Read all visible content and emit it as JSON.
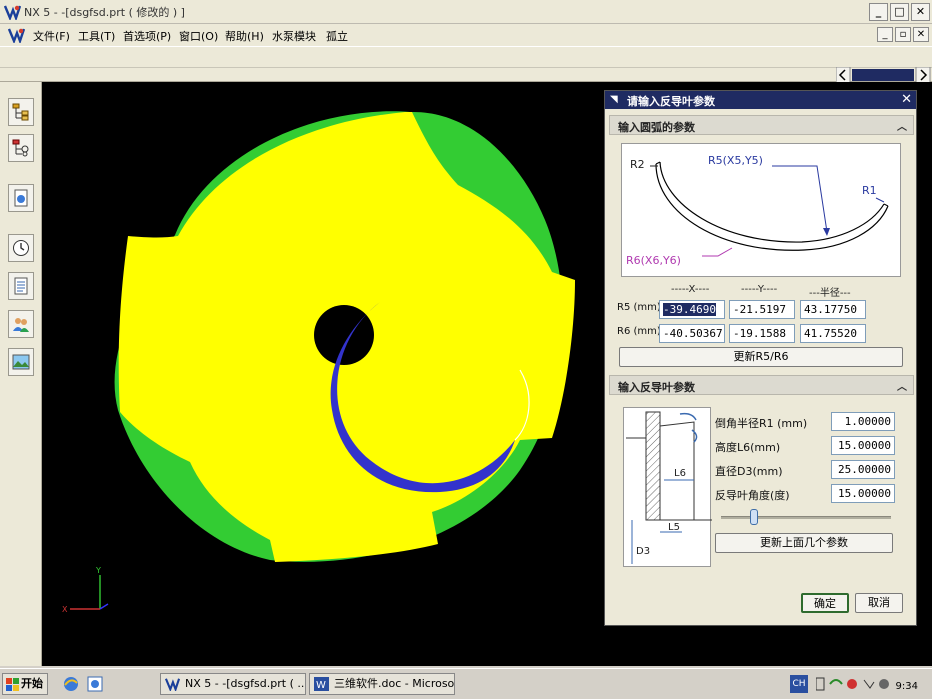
{
  "window": {
    "title": "NX 5 - -[dsgfsd.prt ( 修改的 ) ]",
    "controls": {
      "minimize": "_",
      "maximize": "□",
      "close": "✕"
    }
  },
  "menu": {
    "items": [
      "文件(F)",
      "工具(T)",
      "首选项(P)",
      "窗口(O)",
      "帮助(H)",
      "水泵模块",
      "孤立"
    ]
  },
  "viewport": {
    "triad": {
      "x_label": "X",
      "y_label": "Y"
    },
    "colors": {
      "background": "#000000",
      "impeller_face": "#ffff00",
      "impeller_side": "#33cc33",
      "blade": "#3333cc"
    }
  },
  "dialog": {
    "title": "请输入反导叶参数",
    "section1": {
      "title": "输入圆弧的参数",
      "figure_labels": {
        "r2": "R2",
        "r5": "R5(X5,Y5)",
        "r1": "R1",
        "r6": "R6(X6,Y6)"
      },
      "col_x": "-----X----",
      "col_y": "-----Y----",
      "col_r": "---半径---",
      "r5_label": "R5 (mm)",
      "r6_label": "R6 (mm)",
      "r5": {
        "x": "-39.4690",
        "y": "-21.5197",
        "r": "43.17750"
      },
      "r6": {
        "x": "-40.50367",
        "y": "-19.1588",
        "r": "41.75520"
      },
      "update_button": "更新R5/R6"
    },
    "section2": {
      "title": "输入反导叶参数",
      "figure_labels": {
        "l6": "L6",
        "l5": "L5",
        "d3": "D3"
      },
      "params": [
        {
          "label": "倒角半径R1 (mm)",
          "value": "1.00000"
        },
        {
          "label": "高度L6(mm)",
          "value": "15.00000"
        },
        {
          "label": "直径D3(mm)",
          "value": "25.00000"
        },
        {
          "label": "反导叶角度(度)",
          "value": "15.00000"
        }
      ],
      "update_button": "更新上面几个参数"
    },
    "ok_button": "确定",
    "cancel_button": "取消"
  },
  "taskbar": {
    "start": "开始",
    "tasks": [
      "NX 5 - -[dsgfsd.prt ( ...",
      "三维软件.doc - Microso..."
    ],
    "language": "CH",
    "clock": "9:34"
  }
}
